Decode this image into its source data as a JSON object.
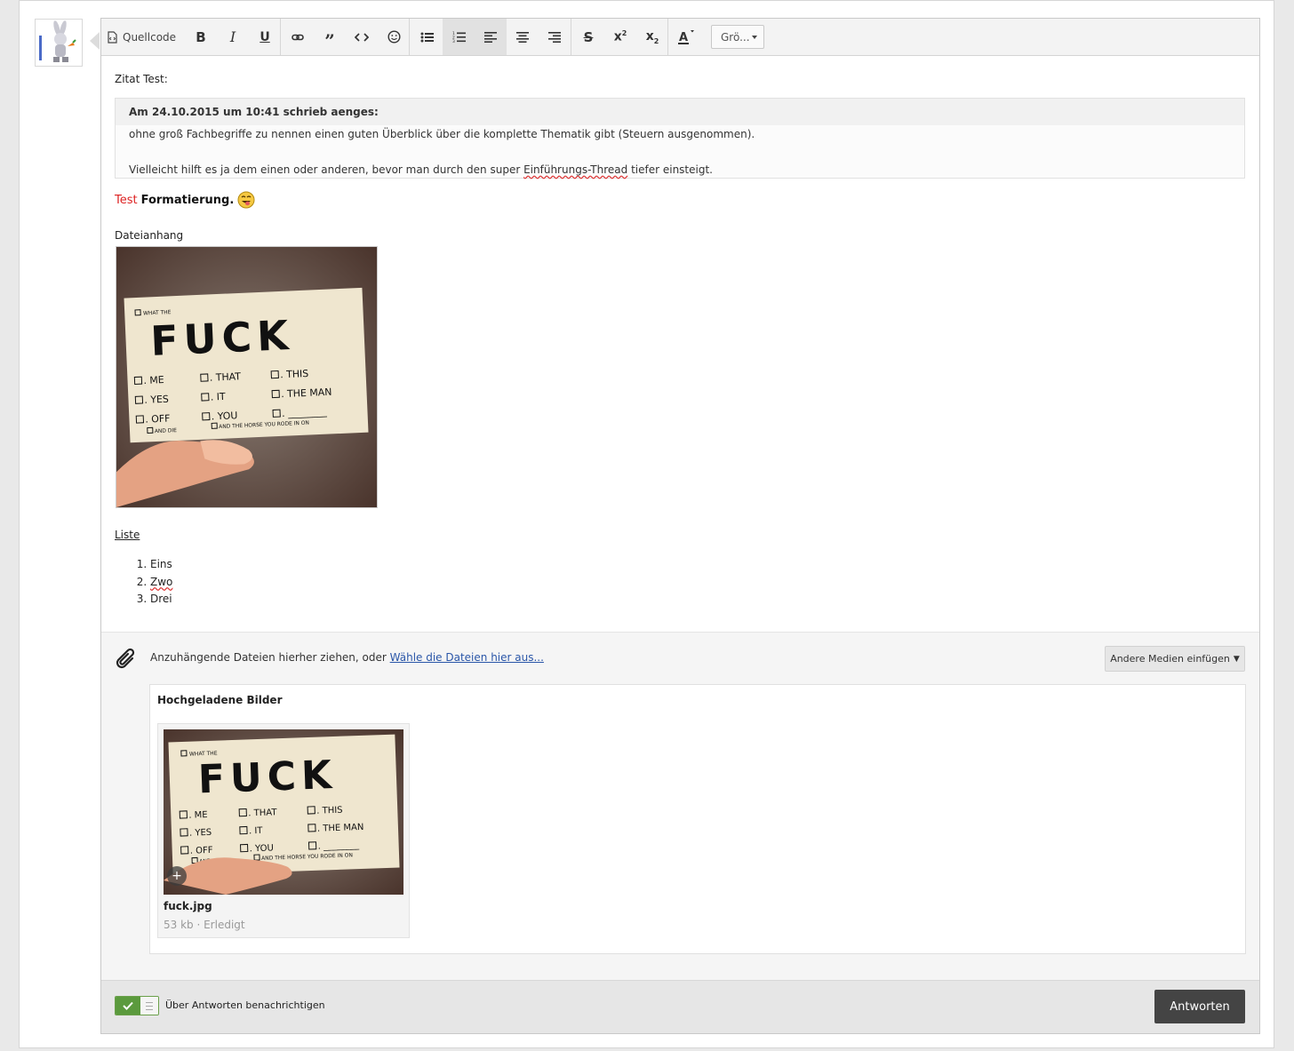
{
  "toolbar": {
    "source_label": "Quellcode",
    "buttons": [
      "bold-icon",
      "italic-icon",
      "underline-icon",
      "link-icon",
      "quote-icon",
      "code-icon",
      "smiley-icon",
      "bullet-list-icon",
      "numbered-list-icon",
      "align-left-icon",
      "align-center-icon",
      "align-right-icon",
      "strikethrough-icon",
      "superscript-icon",
      "subscript-icon",
      "text-color-icon"
    ],
    "font_size_label": "Grö..."
  },
  "content": {
    "quote_intro": "Zitat Test:",
    "quote_header": "Am 24.10.2015 um 10:41 schrieb aenges:",
    "quote_line1": "ohne groß Fachbegriffe zu nennen einen guten Überblick über die komplette Thematik gibt (Steuern ausgenommen).",
    "quote_line2_before": "Vielleicht hilft es ja dem einen oder anderen, bevor man durch den super ",
    "quote_line2_link": "Einführungs-Thread",
    "quote_line2_after": " tiefer einsteigt.",
    "formatting_red": "Test",
    "formatting_bold": "Formatierung.",
    "attachment_label": "Dateianhang",
    "list_title": "Liste",
    "list_items": [
      "Eins",
      "Zwo",
      "Drei"
    ]
  },
  "card_text": {
    "what_the": "WHAT THE",
    "headline": "FUCK",
    "me": ". ME",
    "yes": ". YES",
    "off": ". OFF",
    "and_die": "AND DIE",
    "that": ". THAT",
    "it": ". IT",
    "you": ". YOU",
    "this": ". THIS",
    "the_man": ". THE MAN",
    "blank": ". ________",
    "horse": "AND THE HORSE YOU RODE IN ON"
  },
  "upload": {
    "hint_text": "Anzuhängende Dateien hierher ziehen, oder ",
    "hint_link": "Wähle die Dateien hier aus...",
    "media_button": "Andere Medien einfügen",
    "uploaded_title": "Hochgeladene Bilder",
    "file_name": "fuck.jpg",
    "file_meta": "53 kb · Erledigt"
  },
  "footer": {
    "notify_label": "Über Antworten benachrichtigen",
    "notify_enabled": true,
    "reply_button": "Antworten"
  },
  "colors": {
    "accent_green": "#5b9a3d",
    "reply_button_bg": "#444444",
    "link_blue": "#2a56a8",
    "red_text": "#dd2222"
  }
}
